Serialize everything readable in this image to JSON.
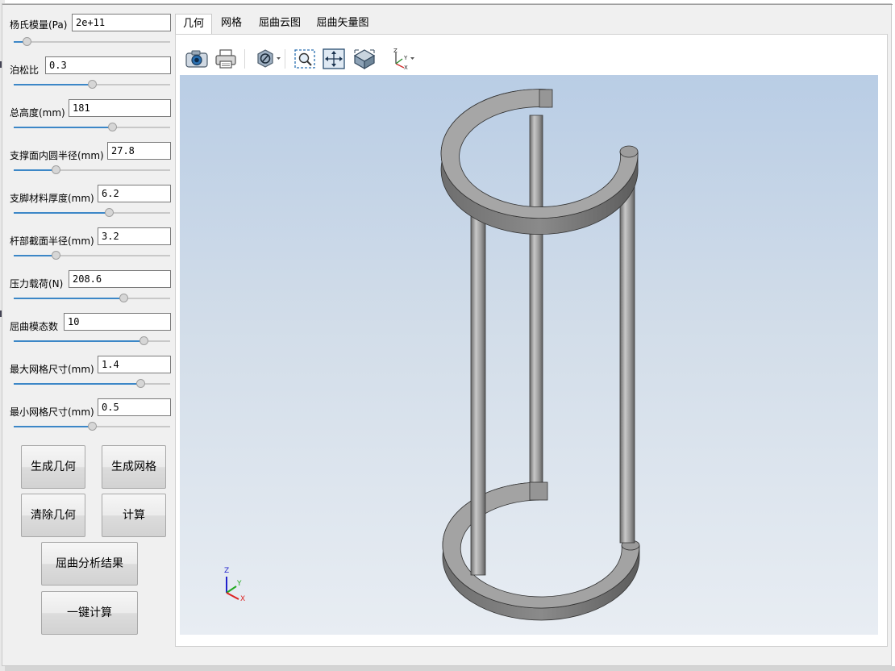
{
  "params": [
    {
      "label": "杨氏模量(Pa)",
      "value": "2e+11",
      "slider": 0.08
    },
    {
      "label": "泊松比",
      "value": "0.3",
      "slider": 0.5
    },
    {
      "label": "总高度(mm)",
      "value": "181",
      "slider": 0.63
    },
    {
      "label": "支撑面内圆半径(mm)",
      "value": "27.8",
      "slider": 0.27
    },
    {
      "label": "支脚材料厚度(mm)",
      "value": "6.2",
      "slider": 0.61
    },
    {
      "label": "杆部截面半径(mm)",
      "value": "3.2",
      "slider": 0.27
    },
    {
      "label": "压力载荷(N)",
      "value": "208.6",
      "slider": 0.7
    },
    {
      "label": "屈曲模态数",
      "value": "10",
      "slider": 0.83
    },
    {
      "label": "最大网格尺寸(mm)",
      "value": "1.4",
      "slider": 0.81
    },
    {
      "label": "最小网格尺寸(mm)",
      "value": "0.5",
      "slider": 0.5
    }
  ],
  "buttons": {
    "gen_geometry": "生成几何",
    "gen_mesh": "生成网格",
    "clear_geometry": "清除几何",
    "compute": "计算",
    "buckling_results": "屈曲分析结果",
    "one_click": "一键计算"
  },
  "tabs": [
    {
      "label": "几何",
      "active": true
    },
    {
      "label": "网格",
      "active": false
    },
    {
      "label": "屈曲云图",
      "active": false
    },
    {
      "label": "屈曲矢量图",
      "active": false
    }
  ],
  "toolbar_icons": [
    "camera-icon",
    "printer-icon",
    "render-style-icon",
    "zoom-box-icon",
    "fit-all-icon",
    "isometric-view-icon",
    "axes-view-icon"
  ],
  "triad": {
    "x": "X",
    "y": "Y",
    "z": "Z"
  },
  "colors": {
    "accent": "#3c87c7",
    "viewport_top": "#b9cde5",
    "viewport_bottom": "#e8edf3",
    "model": "#8e8e8e"
  }
}
